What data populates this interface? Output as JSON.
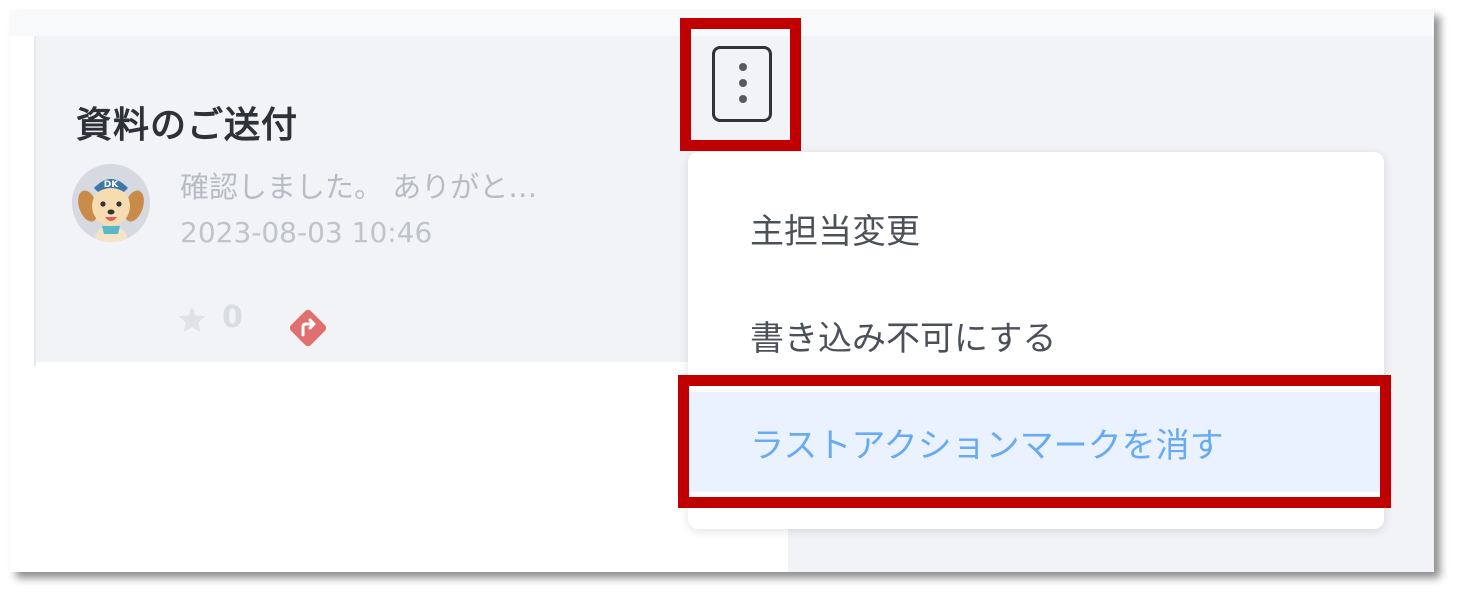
{
  "card": {
    "title": "資料のご送付",
    "preview": "確認しました。 ありがと…",
    "timestamp": "2023-08-03 10:46",
    "star_count": "0",
    "avatar_text": "DK"
  },
  "menu": {
    "items": [
      {
        "label": "主担当変更"
      },
      {
        "label": "書き込み不可にする"
      },
      {
        "label": "ラストアクションマークを消す"
      }
    ]
  },
  "colors": {
    "highlight": "#c00000",
    "active_text": "#6aaaf2",
    "active_bg": "#e9f2fe",
    "action_mark": "#e07070"
  },
  "icons": [
    "avatar-dog",
    "star-icon",
    "action-mark-icon",
    "more-vertical-icon"
  ]
}
